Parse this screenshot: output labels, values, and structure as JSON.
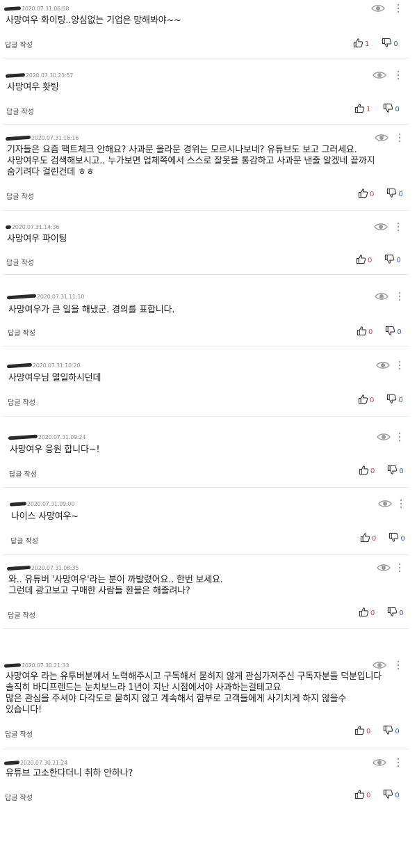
{
  "labels": {
    "reply": "답글 작성"
  },
  "colors": {
    "like_count": "#d83a3a",
    "dislike_count": "#2f62c8",
    "separator": "#ebebeb"
  },
  "icons": {
    "view": "eye-icon",
    "more": "more-vertical-icon",
    "like": "thumbs-up-icon",
    "dislike": "thumbs-down-icon"
  },
  "comments": [
    {
      "date": "2020.07.31.06:58",
      "text": "사망여우  화이팅..양심없는 기업은 망해봐야~~",
      "likes": "1",
      "dislikes": "0"
    },
    {
      "date": "2020.07.30.23:57",
      "text": "사망여우 홧팅",
      "likes": "1",
      "dislikes": "0"
    },
    {
      "date": "2020.07.31.16:16",
      "text": "기자들은 요즘 팩트체크 안해요? 사과문 올라운 경위는 모르시나보네? 유튜브도 보고 그러세요.\n사망여우도 검색해보시고.. 누가보면 업체쪽에서 스스로 잘못을 통감하고 사과문 낸줄 알겠네 끝까지\n숨기려다 걸린건데 ㅎㅎ",
      "likes": "0",
      "dislikes": "0"
    },
    {
      "date": "2020.07.31.14:36",
      "text": "사망여우 파이팅",
      "likes": "0",
      "dislikes": "0"
    },
    {
      "date": "2020.07.31.11:10",
      "text": "사망여우가 큰 일을 해냈군. 경의를 표합니다.",
      "likes": "0",
      "dislikes": "0"
    },
    {
      "date": "2020.07.31.10:20",
      "text": "사망여우님 열일하시던데",
      "likes": "0",
      "dislikes": "0"
    },
    {
      "date": "2020.07.31.09:24",
      "text": "사망여우 응원 합니다~!",
      "likes": "0",
      "dislikes": "0"
    },
    {
      "date": "2020.07.31.09:00",
      "text": "나이스 사망여우~",
      "likes": "0",
      "dislikes": "0"
    },
    {
      "date": "2020.07.31.08:35",
      "text": "와.. 유튜버 '사망여우'라는 분이 까발렸어요.. 한번 보세요.\n그런데 광고보고 구매한 사람들 환불은 해줄려나?",
      "likes": "0",
      "dislikes": "0"
    },
    {
      "date": "2020.07.30.21:33",
      "text": "사망여우 라는 유투버분께서 노력해주시고 구독해서 묻히지 않게 관심가져주신 구독자분들 덕분입니다\n솔직히 바디프렌드는 눈치보느라 1년이 지난 시점에서야 사과하는걸테고요\n많은 관심을 주셔야 다각도로 묻히지 않고 계속해서 함부로 고객들에게 사기치게 하지 않을수\n있습니다!",
      "likes": "0",
      "dislikes": "0"
    },
    {
      "date": "2020.07.30.21:24",
      "text": "유튜브 고소한다더니 취하 안하나?",
      "likes": "0",
      "dislikes": "0"
    }
  ]
}
